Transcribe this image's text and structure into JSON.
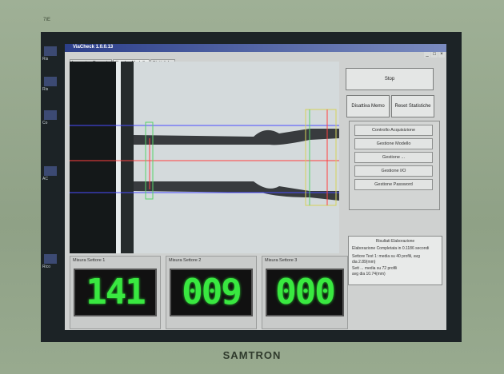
{
  "monitor": {
    "brand": "SAMTRON",
    "corner_mark": "7IE"
  },
  "desktop": {
    "icon_labels": [
      "Ris",
      "Ris",
      "Co",
      "AC",
      "Rico"
    ]
  },
  "window": {
    "title": "ViaCheck 1.0.0.13",
    "controls": [
      "_",
      "□",
      "×"
    ]
  },
  "tabs": [
    {
      "label": "Immagine Corrente",
      "active": false
    },
    {
      "label": "Overlay Modello",
      "active": true
    },
    {
      "label": "Statistiche",
      "active": false
    }
  ],
  "buttons": {
    "stop": "Stop",
    "toggle_memory": "Disattiva Memo",
    "reset_stats": "Reset Statistiche"
  },
  "menu": [
    "Controllo Acquisizione",
    "Gestione Modello",
    "Gestione ...",
    "Gestione I/O",
    "Gestione Password"
  ],
  "results": {
    "title": "Risultati Elaborazione",
    "lines": [
      "Elaborazione Completata in 0.1186 secondi",
      "Settore Test 1: media su 40 profili, avg",
      "dia 2.89(mm)",
      "Sett ... media su 72 profili",
      "avg dia 10.74(mm)"
    ]
  },
  "sensors": [
    {
      "label": "Misura Settore 1",
      "value": "141"
    },
    {
      "label": "Misura Settore 2",
      "value": "009"
    },
    {
      "label": "Misura Settore 3",
      "value": "000"
    }
  ],
  "colors": {
    "digit_green": "#39e840",
    "overlay_blue": "#4a4cff",
    "overlay_red": "#ff4040",
    "overlay_green": "#58d36a",
    "overlay_yellow": "#d6d35a"
  }
}
